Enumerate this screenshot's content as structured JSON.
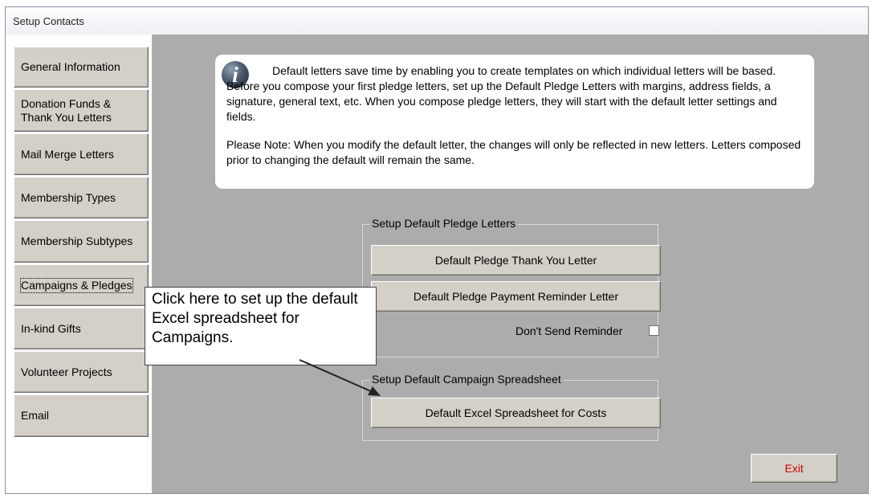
{
  "window": {
    "title": "Setup Contacts"
  },
  "sidebar": {
    "items": [
      {
        "label": "General Information"
      },
      {
        "label": "Donation Funds & Thank You Letters"
      },
      {
        "label": "Mail Merge Letters"
      },
      {
        "label": "Membership Types"
      },
      {
        "label": "Membership Subtypes"
      },
      {
        "label": "Campaigns & Pledges"
      },
      {
        "label": "In-kind Gifts"
      },
      {
        "label": "Volunteer Projects"
      },
      {
        "label": "Email"
      }
    ]
  },
  "info": {
    "icon": "info-icon",
    "icon_glyph": "i",
    "paragraph1": "Default letters save time by enabling you to create templates on which individual letters will be based. Before you compose your first pledge letters, set up the Default Pledge Letters with margins, address fields, a signature, general text, etc. When you compose pledge letters, they will start with the default letter settings and fields.",
    "paragraph2": "Please Note:  When you modify the default letter, the changes will only be reflected in new letters. Letters composed prior to changing the default will remain the same."
  },
  "pledge_group": {
    "title": "Setup Default Pledge Letters",
    "thank_you_button": "Default Pledge Thank You Letter",
    "reminder_button": "Default Pledge Payment Reminder Letter",
    "dont_send_label": "Don't Send Reminder",
    "dont_send_checked": false
  },
  "campaign_group": {
    "title": "Setup Default Campaign Spreadsheet",
    "excel_button": "Default Excel Spreadsheet for Costs"
  },
  "exit_button": "Exit",
  "callout": {
    "text": "Click here to set up the default Excel spreadsheet for Campaigns."
  }
}
